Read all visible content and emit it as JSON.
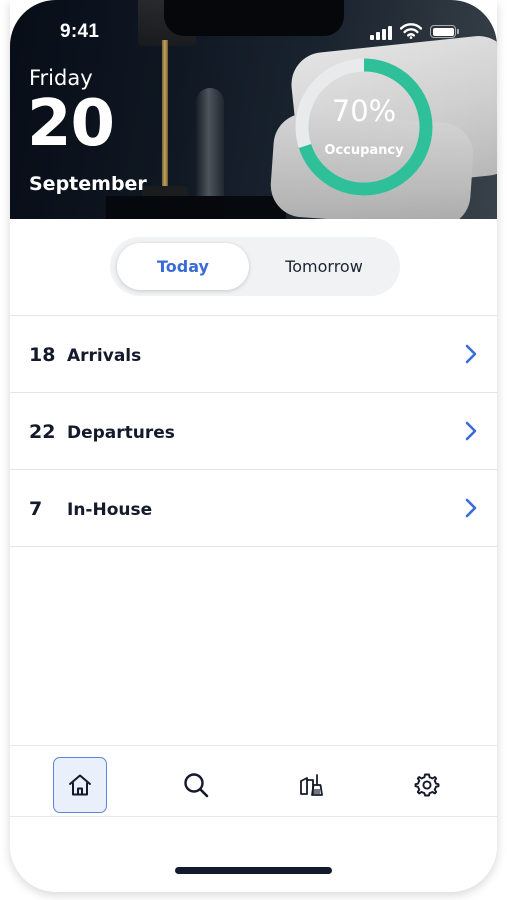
{
  "status_bar": {
    "time": "9:41",
    "icons": [
      "cellular-signal-icon",
      "wifi-icon",
      "battery-icon"
    ]
  },
  "header": {
    "day_of_week": "Friday",
    "day_number": "20",
    "month": "September",
    "occupancy": {
      "percent_text": "70%",
      "label": "Occupancy",
      "value": 0.7,
      "ring_color": "#2fc09a",
      "track_color": "#e8eaec"
    }
  },
  "segmented_control": {
    "options": [
      "Today",
      "Tomorrow"
    ],
    "selected": "Today",
    "accent_color": "#3a6bd6"
  },
  "summary": {
    "items": [
      {
        "count": "18",
        "label": "Arrivals",
        "icon": "chevron-right-icon"
      },
      {
        "count": "22",
        "label": "Departures",
        "icon": "chevron-right-icon"
      },
      {
        "count": "7",
        "label": "In-House",
        "icon": "chevron-right-icon"
      }
    ]
  },
  "tab_bar": {
    "items": [
      {
        "icon": "home-icon",
        "active": true
      },
      {
        "icon": "search-icon",
        "active": false
      },
      {
        "icon": "housekeeping-icon",
        "active": false
      },
      {
        "icon": "gear-icon",
        "active": false
      }
    ]
  }
}
